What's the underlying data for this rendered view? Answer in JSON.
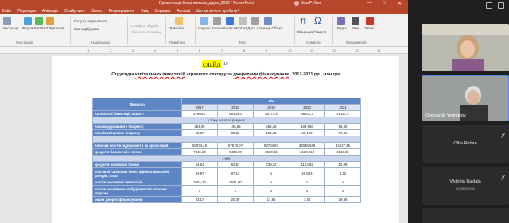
{
  "window": {
    "title": "Презентація Коваленкова_даріa_2022 - PowerPoint",
    "user": "Віка Рубан",
    "controls": [
      "—",
      "□",
      "✕"
    ]
  },
  "menu": [
    "Файл",
    "Переходи",
    "Анімація",
    "Слайд-шоу",
    "Запис",
    "Рецензування",
    "Вид",
    "Справка",
    "Acrobat",
    "Що ви хочете зробити?"
  ],
  "ribbon": {
    "buttons": [
      "Ілюстрації",
      "Фігури SmartArt Діаграма",
      "Почути надсилання",
      "Мої надбудови",
      "Слайд з обґрунт.",
      "Зберегти вказівки",
      "Примітки",
      "Надпис Колонтитули WordArt Дата й Номер Об'єкт",
      "Рівняння",
      "Символ",
      "Відео",
      "Звук",
      "Запис"
    ],
    "groups": [
      "Ілюстрації",
      "Надбудови",
      "Примітки",
      "Текст",
      "Символи",
      "Мультимедія"
    ],
    "extra_labels": [
      "Зображення",
      "Запис екрана",
      "слайд"
    ]
  },
  "ruler": [
    "1",
    "2",
    "3",
    "4",
    "5",
    "6",
    "7",
    "8",
    "9",
    "10",
    "11",
    "12",
    "13",
    "14"
  ],
  "slide": {
    "label": "слайд",
    "number": "10",
    "title_parts": [
      "Структура ",
      "капітальних інвестицій",
      " аграрного сектору за ",
      "джерелами фінансування",
      ", 2017-2021 рр., млн грн"
    ]
  },
  "table": {
    "header_label": "Джерело",
    "header_group": "Рік",
    "years": [
      "2017",
      "2018",
      "2019",
      "2020",
      "2021"
    ],
    "rows": [
      {
        "label": "Капітальні інвестиції, всього",
        "values": [
          "57804,7",
          "66104,3",
          "59170,5",
          "36441,3",
          "49117,4"
        ]
      },
      {
        "span": "у тому числі за рахунок:"
      },
      {
        "label": "Коштів державного бюджету",
        "values": [
          "384,05",
          "136,66",
          "252,26",
          "103,666",
          "96,80"
        ]
      },
      {
        "label": "Коштів місцевого бюджету",
        "values": [
          "69,37",
          "80,86",
          "105,88",
          "31,108",
          "87,46"
        ]
      },
      {
        "span": ""
      },
      {
        "label": "власних коштів підприємств та організацій",
        "values": [
          "50874,48",
          "57578,07",
          "53704,87",
          "33035,948",
          "44627,35"
        ]
      },
      {
        "label": "кредитів банків та ін. позик",
        "values": [
          "7346,98",
          "8400,80",
          "5030,35",
          "3138,918",
          "4310,69"
        ]
      },
      {
        "span": "з них:"
      },
      {
        "label": "кредитів іноземних банків",
        "values": [
          "54,91",
          "82,57",
          "739,12",
          "110,052",
          "52,09"
        ]
      },
      {
        "label": "коштів вітчизняних інвестиційних компаній, фондів, тощо",
        "values": [
          "84,97",
          "97,12",
          "х",
          "20,533",
          "0,22"
        ],
        "tall": true
      },
      {
        "label": "коштів іноземних інвесторів",
        "values": [
          "3554,30",
          "4071,00",
          "х",
          "х",
          "х"
        ]
      },
      {
        "label": "коштів населення на будівництво власних квартир",
        "values": [
          "х",
          "х",
          "х",
          "х",
          "х"
        ],
        "tall": true
      },
      {
        "label": "інших джерел фінансування",
        "values": [
          "23,17",
          "20,49",
          "17,85",
          "7,48",
          "29,36"
        ]
      }
    ]
  },
  "participants": [
    {
      "name": "",
      "role": "",
      "kind": "video-woman"
    },
    {
      "name": "Oleksandr Yermakov",
      "role": "",
      "kind": "video-man",
      "active": true
    },
    {
      "name": "Olha Ruban",
      "role": ""
    },
    {
      "name": "Viktoriia Baidala",
      "role": "організатор"
    },
    {
      "name": "",
      "role": ""
    }
  ],
  "colors": {
    "ppt_accent": "#b7472a",
    "table_header": "#5f86c4",
    "highlight": "#ffff00",
    "active_speaker": "#4a8cf0"
  }
}
